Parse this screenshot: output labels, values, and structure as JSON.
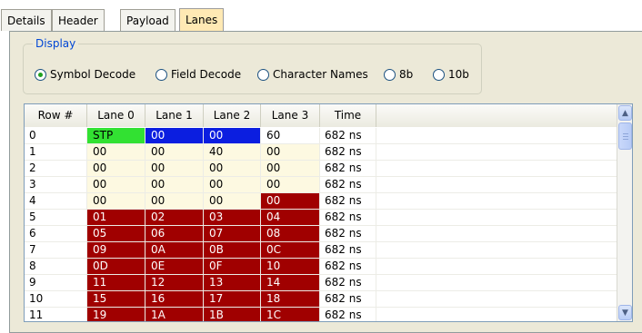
{
  "tabs": [
    {
      "label": "Details",
      "active": false
    },
    {
      "label": "Header",
      "active": false
    },
    {
      "label": "Payload",
      "active": false
    },
    {
      "label": "Lanes",
      "active": true
    }
  ],
  "display": {
    "caption": "Display",
    "options": [
      {
        "label": "Symbol Decode",
        "checked": true
      },
      {
        "label": "Field Decode",
        "checked": false
      },
      {
        "label": "Character Names",
        "checked": false
      },
      {
        "label": "8b",
        "checked": false
      },
      {
        "label": "10b",
        "checked": false
      }
    ]
  },
  "grid": {
    "columns": [
      "Row #",
      "Lane 0",
      "Lane 1",
      "Lane 2",
      "Lane 3",
      "Time"
    ],
    "colors": {
      "green": "#32e132",
      "blue": "#0b1ee0",
      "dark_red": "#a00000",
      "cream": "#fdf9e1",
      "white": "#ffffff"
    },
    "rows": [
      {
        "row": "0",
        "lanes": [
          "STP",
          "00",
          "00",
          "60"
        ],
        "colors": [
          "green",
          "blue",
          "blue",
          "white"
        ],
        "time": "682 ns"
      },
      {
        "row": "1",
        "lanes": [
          "00",
          "00",
          "40",
          "00"
        ],
        "colors": [
          "cream",
          "cream",
          "cream",
          "cream"
        ],
        "time": "682 ns"
      },
      {
        "row": "2",
        "lanes": [
          "00",
          "00",
          "00",
          "00"
        ],
        "colors": [
          "cream",
          "cream",
          "cream",
          "cream"
        ],
        "time": "682 ns"
      },
      {
        "row": "3",
        "lanes": [
          "00",
          "00",
          "00",
          "00"
        ],
        "colors": [
          "cream",
          "cream",
          "cream",
          "cream"
        ],
        "time": "682 ns"
      },
      {
        "row": "4",
        "lanes": [
          "00",
          "00",
          "00",
          "00"
        ],
        "colors": [
          "cream",
          "cream",
          "cream",
          "dark_red"
        ],
        "time": "682 ns"
      },
      {
        "row": "5",
        "lanes": [
          "01",
          "02",
          "03",
          "04"
        ],
        "colors": [
          "dark_red",
          "dark_red",
          "dark_red",
          "dark_red"
        ],
        "time": "682 ns"
      },
      {
        "row": "6",
        "lanes": [
          "05",
          "06",
          "07",
          "08"
        ],
        "colors": [
          "dark_red",
          "dark_red",
          "dark_red",
          "dark_red"
        ],
        "time": "682 ns"
      },
      {
        "row": "7",
        "lanes": [
          "09",
          "0A",
          "0B",
          "0C"
        ],
        "colors": [
          "dark_red",
          "dark_red",
          "dark_red",
          "dark_red"
        ],
        "time": "682 ns"
      },
      {
        "row": "8",
        "lanes": [
          "0D",
          "0E",
          "0F",
          "10"
        ],
        "colors": [
          "dark_red",
          "dark_red",
          "dark_red",
          "dark_red"
        ],
        "time": "682 ns"
      },
      {
        "row": "9",
        "lanes": [
          "11",
          "12",
          "13",
          "14"
        ],
        "colors": [
          "dark_red",
          "dark_red",
          "dark_red",
          "dark_red"
        ],
        "time": "682 ns"
      },
      {
        "row": "10",
        "lanes": [
          "15",
          "16",
          "17",
          "18"
        ],
        "colors": [
          "dark_red",
          "dark_red",
          "dark_red",
          "dark_red"
        ],
        "time": "682 ns"
      },
      {
        "row": "11",
        "lanes": [
          "19",
          "1A",
          "1B",
          "1C"
        ],
        "colors": [
          "dark_red",
          "dark_red",
          "dark_red",
          "dark_red"
        ],
        "time": "682 ns"
      }
    ]
  },
  "scrollbar": {
    "up_icon": "chevron-up-icon",
    "down_icon": "chevron-down-icon",
    "up_glyph": "▲",
    "down_glyph": "▼"
  }
}
